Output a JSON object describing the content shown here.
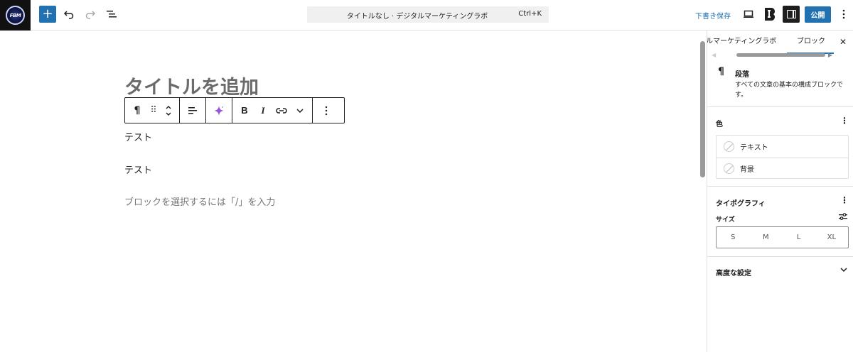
{
  "topbar": {
    "site_icon_text": "FBM",
    "add_block_label": "+",
    "undo_icon": "undo-icon",
    "redo_icon": "redo-icon",
    "list_view_icon": "list-view-icon",
    "command_bar": {
      "title": "タイトルなし · デジタルマーケティングラボ",
      "shortcut": "Ctrl+K"
    },
    "save_draft_label": "下書き保存",
    "preview_icon": "desktop-preview-icon",
    "plugin_icon": "jetpack-boost-icon",
    "settings_icon": "sidebar-settings-icon",
    "publish_label": "公開",
    "options_icon": "more-vertical-icon"
  },
  "editor": {
    "title_placeholder": "タイトルを追加",
    "block_toolbar": {
      "paragraph_icon": "¶",
      "drag_icon": "⠿",
      "align_icon": "align-left-icon",
      "ai_icon": "sparkle-icon",
      "bold_label": "B",
      "italic_label": "I",
      "link_icon": "link-icon",
      "more_icon": "chevron-down-icon",
      "options_icon": "more-vertical-icon"
    },
    "paragraphs": [
      "テスト",
      "テスト"
    ],
    "block_placeholder": "ブロックを選択するには「/」を入力"
  },
  "sidebar": {
    "tabs": [
      {
        "label": "ルマーケティングラボ"
      },
      {
        "label": "ブロック",
        "active": true
      }
    ],
    "close_label": "✕",
    "block": {
      "icon": "¶",
      "name": "段落",
      "description": "すべての文章の基本の構成ブロックです。"
    },
    "color_panel": {
      "title": "色",
      "items": [
        "テキスト",
        "背景"
      ]
    },
    "typography_panel": {
      "title": "タイポグラフィ",
      "size_label": "サイズ",
      "sizes": [
        "S",
        "M",
        "L",
        "XL"
      ]
    },
    "advanced_panel": {
      "title": "高度な設定"
    }
  },
  "colors": {
    "accent": "#2271b1",
    "ai_sparkle": "#9b51e0"
  }
}
